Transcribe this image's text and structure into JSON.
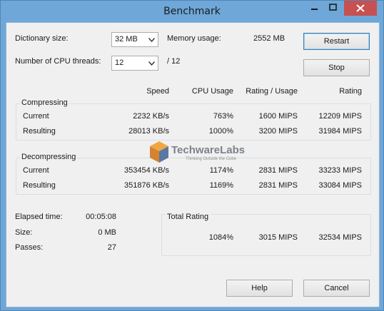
{
  "window": {
    "title": "Benchmark"
  },
  "settings": {
    "dictionary_label": "Dictionary size:",
    "dictionary_value": "32 MB",
    "threads_label": "Number of CPU threads:",
    "threads_value": "12",
    "threads_total": "/ 12",
    "memory_label": "Memory usage:",
    "memory_value": "2552 MB"
  },
  "buttons": {
    "restart": "Restart",
    "stop": "Stop",
    "help": "Help",
    "cancel": "Cancel"
  },
  "columns": {
    "speed": "Speed",
    "cpu": "CPU Usage",
    "rating_usage": "Rating / Usage",
    "rating": "Rating"
  },
  "compressing": {
    "title": "Compressing",
    "rows": [
      {
        "label": "Current",
        "speed": "2232 KB/s",
        "cpu": "763%",
        "rating_usage": "1600 MIPS",
        "rating": "12209 MIPS"
      },
      {
        "label": "Resulting",
        "speed": "28013 KB/s",
        "cpu": "1000%",
        "rating_usage": "3200 MIPS",
        "rating": "31984 MIPS"
      }
    ]
  },
  "decompressing": {
    "title": "Decompressing",
    "rows": [
      {
        "label": "Current",
        "speed": "353454 KB/s",
        "cpu": "1174%",
        "rating_usage": "2831 MIPS",
        "rating": "33233 MIPS"
      },
      {
        "label": "Resulting",
        "speed": "351876 KB/s",
        "cpu": "1169%",
        "rating_usage": "2831 MIPS",
        "rating": "33084 MIPS"
      }
    ]
  },
  "stats": {
    "elapsed_label": "Elapsed time:",
    "elapsed_value": "00:05:08",
    "size_label": "Size:",
    "size_value": "0 MB",
    "passes_label": "Passes:",
    "passes_value": "27"
  },
  "total": {
    "title": "Total Rating",
    "cpu": "1084%",
    "rating_usage": "3015 MIPS",
    "rating": "32534 MIPS"
  },
  "watermark": {
    "brand": "TechwareLabs",
    "tagline": "Thinking Outside the Cube"
  },
  "colors": {
    "frame": "#6ea7d8",
    "close_button": "#c75050",
    "dialog_bg": "#f0f0f0",
    "group_border": "#d5dfe5",
    "default_button_border": "#3c7fb1"
  },
  "icons": {
    "minimize": "minimize-icon",
    "maximize": "maximize-icon",
    "close": "close-icon",
    "dropdown": "chevron-down-icon"
  }
}
